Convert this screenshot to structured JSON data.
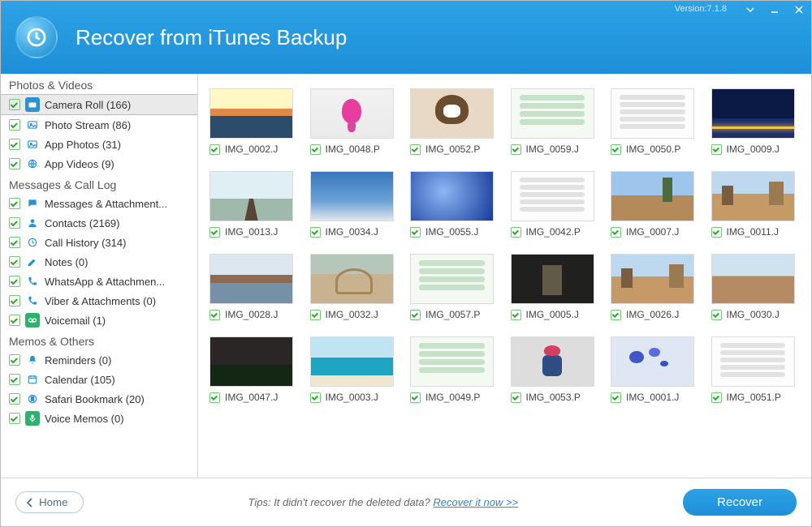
{
  "version_label": "Version:7.1.8",
  "title": "Recover from iTunes Backup",
  "sidebar": {
    "sections": [
      {
        "heading": "Photos & Videos",
        "items": [
          {
            "label": "Camera Roll (166)",
            "icon": "camera",
            "selected": true
          },
          {
            "label": "Photo Stream (86)",
            "icon": "image"
          },
          {
            "label": "App Photos (31)",
            "icon": "image"
          },
          {
            "label": "App Videos (9)",
            "icon": "globe"
          }
        ]
      },
      {
        "heading": "Messages & Call Log",
        "items": [
          {
            "label": "Messages & Attachment...",
            "icon": "chat"
          },
          {
            "label": "Contacts (2169)",
            "icon": "contact"
          },
          {
            "label": "Call History (314)",
            "icon": "clock"
          },
          {
            "label": "Notes (0)",
            "icon": "pencil"
          },
          {
            "label": "WhatsApp & Attachmen...",
            "icon": "phone"
          },
          {
            "label": "Viber & Attachments (0)",
            "icon": "phone"
          },
          {
            "label": "Voicemail (1)",
            "icon": "voicemail",
            "green": true
          }
        ]
      },
      {
        "heading": "Memos & Others",
        "items": [
          {
            "label": "Reminders (0)",
            "icon": "bell"
          },
          {
            "label": "Calendar (105)",
            "icon": "calendar"
          },
          {
            "label": "Safari Bookmark (20)",
            "icon": "bookmark"
          },
          {
            "label": "Voice Memos (0)",
            "icon": "mic",
            "green": true
          }
        ]
      }
    ]
  },
  "thumbnails": [
    {
      "name": "IMG_0002.J",
      "style": "sunset"
    },
    {
      "name": "IMG_0048.P",
      "style": "flower"
    },
    {
      "name": "IMG_0052.P",
      "style": "cat"
    },
    {
      "name": "IMG_0059.J",
      "style": "phone"
    },
    {
      "name": "IMG_0050.P",
      "style": "phone2"
    },
    {
      "name": "IMG_0009.J",
      "style": "night"
    },
    {
      "name": "IMG_0013.J",
      "style": "pier"
    },
    {
      "name": "IMG_0034.J",
      "style": "sky"
    },
    {
      "name": "IMG_0055.J",
      "style": "blue"
    },
    {
      "name": "IMG_0042.P",
      "style": "phone2"
    },
    {
      "name": "IMG_0007.J",
      "style": "town1"
    },
    {
      "name": "IMG_0011.J",
      "style": "town2"
    },
    {
      "name": "IMG_0028.J",
      "style": "river"
    },
    {
      "name": "IMG_0032.J",
      "style": "colosseum"
    },
    {
      "name": "IMG_0057.P",
      "style": "phone"
    },
    {
      "name": "IMG_0005.J",
      "style": "doorway"
    },
    {
      "name": "IMG_0026.J",
      "style": "town2"
    },
    {
      "name": "IMG_0030.J",
      "style": "town3"
    },
    {
      "name": "IMG_0047.J",
      "style": "field"
    },
    {
      "name": "IMG_0003.J",
      "style": "beach"
    },
    {
      "name": "IMG_0049.P",
      "style": "phone"
    },
    {
      "name": "IMG_0053.P",
      "style": "kid"
    },
    {
      "name": "IMG_0001.J",
      "style": "flowers2"
    },
    {
      "name": "IMG_0051.P",
      "style": "phone2"
    }
  ],
  "footer": {
    "home": "Home",
    "tips_text": "Tips: It didn't recover the deleted data? ",
    "tips_link": "Recover it now >>",
    "recover": "Recover"
  }
}
